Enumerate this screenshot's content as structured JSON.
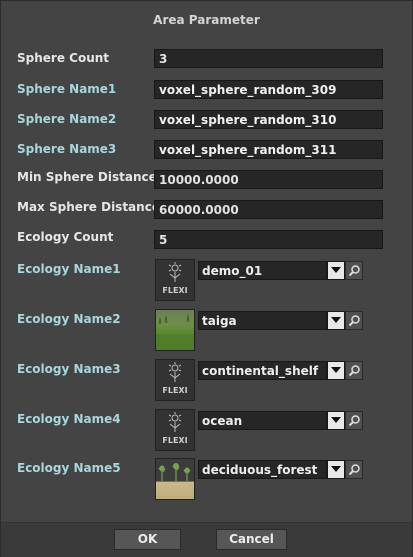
{
  "dialog": {
    "title": "Area Parameter"
  },
  "params": {
    "sphere_count": {
      "label": "Sphere Count",
      "value": "3"
    },
    "sphere_name1": {
      "label": "Sphere Name1",
      "value": "voxel_sphere_random_309"
    },
    "sphere_name2": {
      "label": "Sphere Name2",
      "value": "voxel_sphere_random_310"
    },
    "sphere_name3": {
      "label": "Sphere Name3",
      "value": "voxel_sphere_random_311"
    },
    "min_sphere_distance": {
      "label": "Min Sphere Distance",
      "value": "10000.0000"
    },
    "max_sphere_distance": {
      "label": "Max Sphere Distance",
      "value": "60000.0000"
    },
    "ecology_count": {
      "label": "Ecology Count",
      "value": "5"
    }
  },
  "ecologies": [
    {
      "label": "Ecology Name1",
      "value": "demo_01",
      "thumbnail": "flexi-logo",
      "thumb_text": "FLEXI"
    },
    {
      "label": "Ecology Name2",
      "value": "taiga",
      "thumbnail": "grass-image"
    },
    {
      "label": "Ecology Name3",
      "value": "continental_shelf",
      "thumbnail": "flexi-logo",
      "thumb_text": "FLEXI"
    },
    {
      "label": "Ecology Name4",
      "value": "ocean",
      "thumbnail": "flexi-logo",
      "thumb_text": "FLEXI"
    },
    {
      "label": "Ecology Name5",
      "value": "deciduous_forest",
      "thumbnail": "forest-image"
    }
  ],
  "buttons": {
    "ok": "OK",
    "cancel": "Cancel"
  },
  "colors": {
    "background": "#444444",
    "field_bg": "#262626",
    "label_text": "#e6e6e6",
    "accent_label_text": "#a9d6dd",
    "footer_bg": "#3a3a3a"
  },
  "icons": {
    "dropdown": "chevron-down-icon",
    "browse": "magnifier-icon"
  }
}
